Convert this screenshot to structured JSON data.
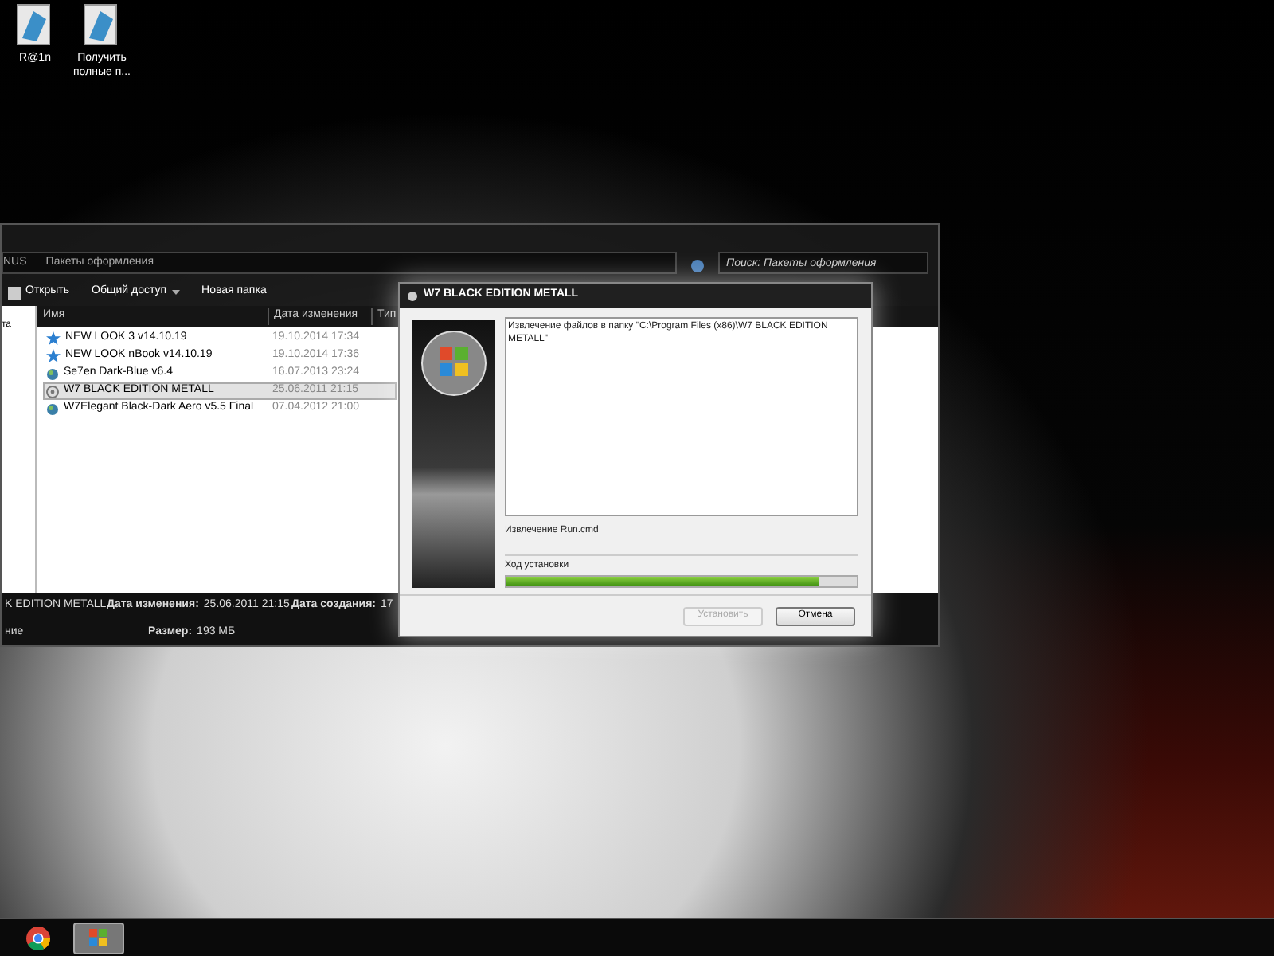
{
  "desktop_icons": [
    {
      "label": "R@1n"
    },
    {
      "label": "Получить полные п..."
    }
  ],
  "explorer": {
    "address": [
      "NUS",
      "Пакеты оформления"
    ],
    "search": {
      "placeholder": "Поиск: Пакеты оформления"
    },
    "toolbar": [
      {
        "label": "Открыть",
        "kind": "icon"
      },
      {
        "label": "Общий доступ",
        "kind": "menu"
      },
      {
        "label": "Новая папка",
        "kind": "plain"
      }
    ],
    "nav_items": [
      {
        "label": "та"
      }
    ],
    "columns": [
      "Имя",
      "Дата изменения",
      "Тип"
    ],
    "rows": [
      {
        "name": "NEW LOOK 3 v14.10.19",
        "date": "19.10.2014 17:34",
        "kind": "star",
        "selected": false
      },
      {
        "name": "NEW LOOK nBook v14.10.19",
        "date": "19.10.2014 17:36",
        "kind": "star",
        "selected": false
      },
      {
        "name": "Se7en Dark-Blue v6.4",
        "date": "16.07.2013 23:24",
        "kind": "globe",
        "selected": false
      },
      {
        "name": "W7 BLACK EDITION METALL",
        "date": "25.06.2011 21:15",
        "kind": "disc",
        "selected": true
      },
      {
        "name": "W7Elegant Black-Dark Aero v5.5 Final",
        "date": "07.04.2012 21:00",
        "kind": "globe",
        "selected": false
      }
    ],
    "details": {
      "title": "K EDITION METALL",
      "subtitle": "ние",
      "fields": [
        {
          "label": "Дата изменения:",
          "value": "25.06.2011 21:15"
        },
        {
          "label": "Дата создания:",
          "value": "17"
        },
        {
          "label": "Размер:",
          "value": "193 МБ"
        }
      ]
    }
  },
  "installer": {
    "title": "W7 BLACK EDITION METALL",
    "log": "Извлечение файлов в папку \"C:\\Program Files (x86)\\W7 BLACK EDITION METALL\"",
    "status": "Извлечение Run.cmd",
    "progress_label": "Ход установки",
    "level": 0.89,
    "buttons": [
      {
        "label": "Установить",
        "disabled": true
      },
      {
        "label": "Отмена",
        "disabled": false
      }
    ]
  },
  "taskbar": {
    "items": [
      {
        "kind": "chrome",
        "active": false
      },
      {
        "kind": "windows",
        "active": true
      }
    ]
  }
}
